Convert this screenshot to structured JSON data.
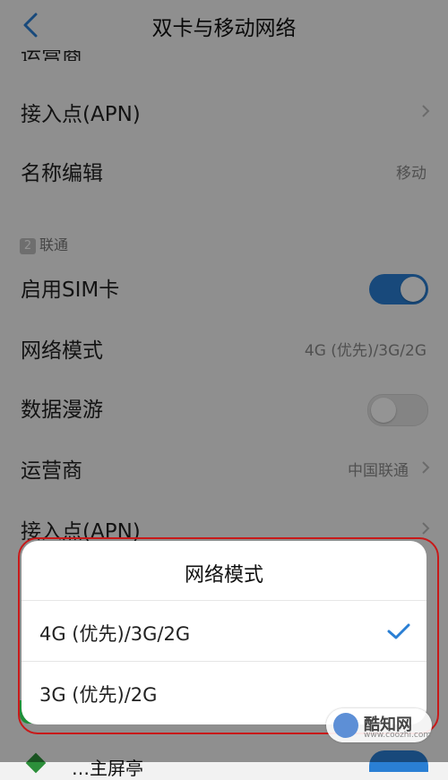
{
  "header": {
    "title": "双卡与移动网络",
    "partial_top_label": "运营商"
  },
  "sim1_rows": [
    {
      "label": "接入点(APN)",
      "value": "",
      "chevron": true
    },
    {
      "label": "名称编辑",
      "value": "移动",
      "chevron": false
    }
  ],
  "sim2": {
    "badge": "2",
    "section_label": "联通",
    "enable_sim": {
      "label": "启用SIM卡",
      "on": true
    },
    "network_mode": {
      "label": "网络模式",
      "value": "4G (优先)/3G/2G"
    },
    "data_roaming": {
      "label": "数据漫游",
      "on": false
    },
    "carrier": {
      "label": "运营商",
      "value": "中国联通"
    },
    "apn": {
      "label": "接入点(APN)"
    }
  },
  "dialog": {
    "title": "网络模式",
    "options": [
      {
        "label": "4G (优先)/3G/2G",
        "selected": true
      },
      {
        "label": "3G (优先)/2G",
        "selected": false
      }
    ]
  },
  "behind_bottom": {
    "label": "…主屏亭"
  },
  "watermark": {
    "text": "酷知网",
    "sub": "www.coozhi.com"
  },
  "colors": {
    "accent": "#2a7fd4",
    "highlight_outline": "#c81919"
  },
  "icons": [
    "chevron-left-icon",
    "chevron-right-icon",
    "checkmark-icon"
  ]
}
